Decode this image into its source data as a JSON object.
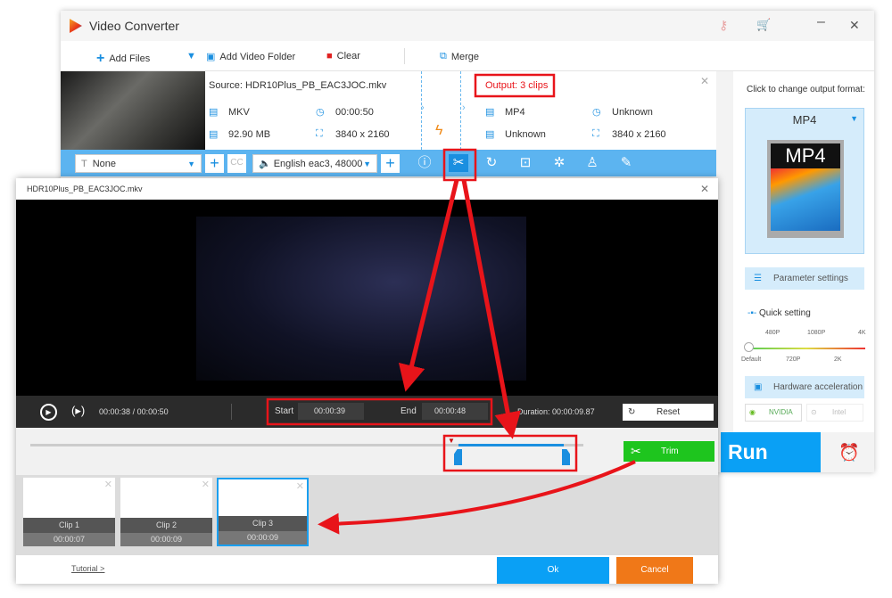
{
  "app": {
    "title": "Video Converter"
  },
  "toolbar": {
    "add_files": "Add Files",
    "add_folder": "Add Video Folder",
    "clear": "Clear",
    "merge": "Merge"
  },
  "file": {
    "source": "Source: HDR10Plus_PB_EAC3JOC.mkv",
    "output": "Output: 3 clips",
    "src_format": "MKV",
    "src_duration": "00:00:50",
    "src_size": "92.90 MB",
    "src_res": "3840 x 2160",
    "out_format": "MP4",
    "out_duration": "Unknown",
    "out_size": "Unknown",
    "out_res": "3840 x 2160"
  },
  "editbar": {
    "subtitle": "None",
    "audio": "English eac3, 48000",
    "cc": "CC"
  },
  "right": {
    "hint": "Click to change output format:",
    "format": "MP4",
    "param": "Parameter settings",
    "quick": "Quick setting",
    "ticks_top": [
      "480P",
      "1080P",
      "4K"
    ],
    "ticks_bottom": [
      "Default",
      "720P",
      "2K"
    ],
    "hw": "Hardware acceleration",
    "nvidia": "NVIDIA",
    "intel": "Intel",
    "run": "Run"
  },
  "dialog": {
    "title": "HDR10Plus_PB_EAC3JOC.mkv",
    "current": "00:00:38",
    "total": "00:00:50",
    "sep": "/",
    "start_label": "Start",
    "start": "00:00:39",
    "end_label": "End",
    "end": "00:00:48",
    "duration_label": "Duration:",
    "duration": "00:00:09.87",
    "reset": "Reset",
    "trim": "Trim",
    "clips": [
      {
        "name": "Clip 1",
        "time": "00:00:07"
      },
      {
        "name": "Clip 2",
        "time": "00:00:09"
      },
      {
        "name": "Clip 3",
        "time": "00:00:09"
      }
    ],
    "tutorial": "Tutorial >",
    "ok": "Ok",
    "cancel": "Cancel"
  },
  "colors": {
    "accent": "#0aa0f5",
    "annotation": "#e8141a",
    "trim": "#1ec51e",
    "cancel": "#f07818"
  }
}
